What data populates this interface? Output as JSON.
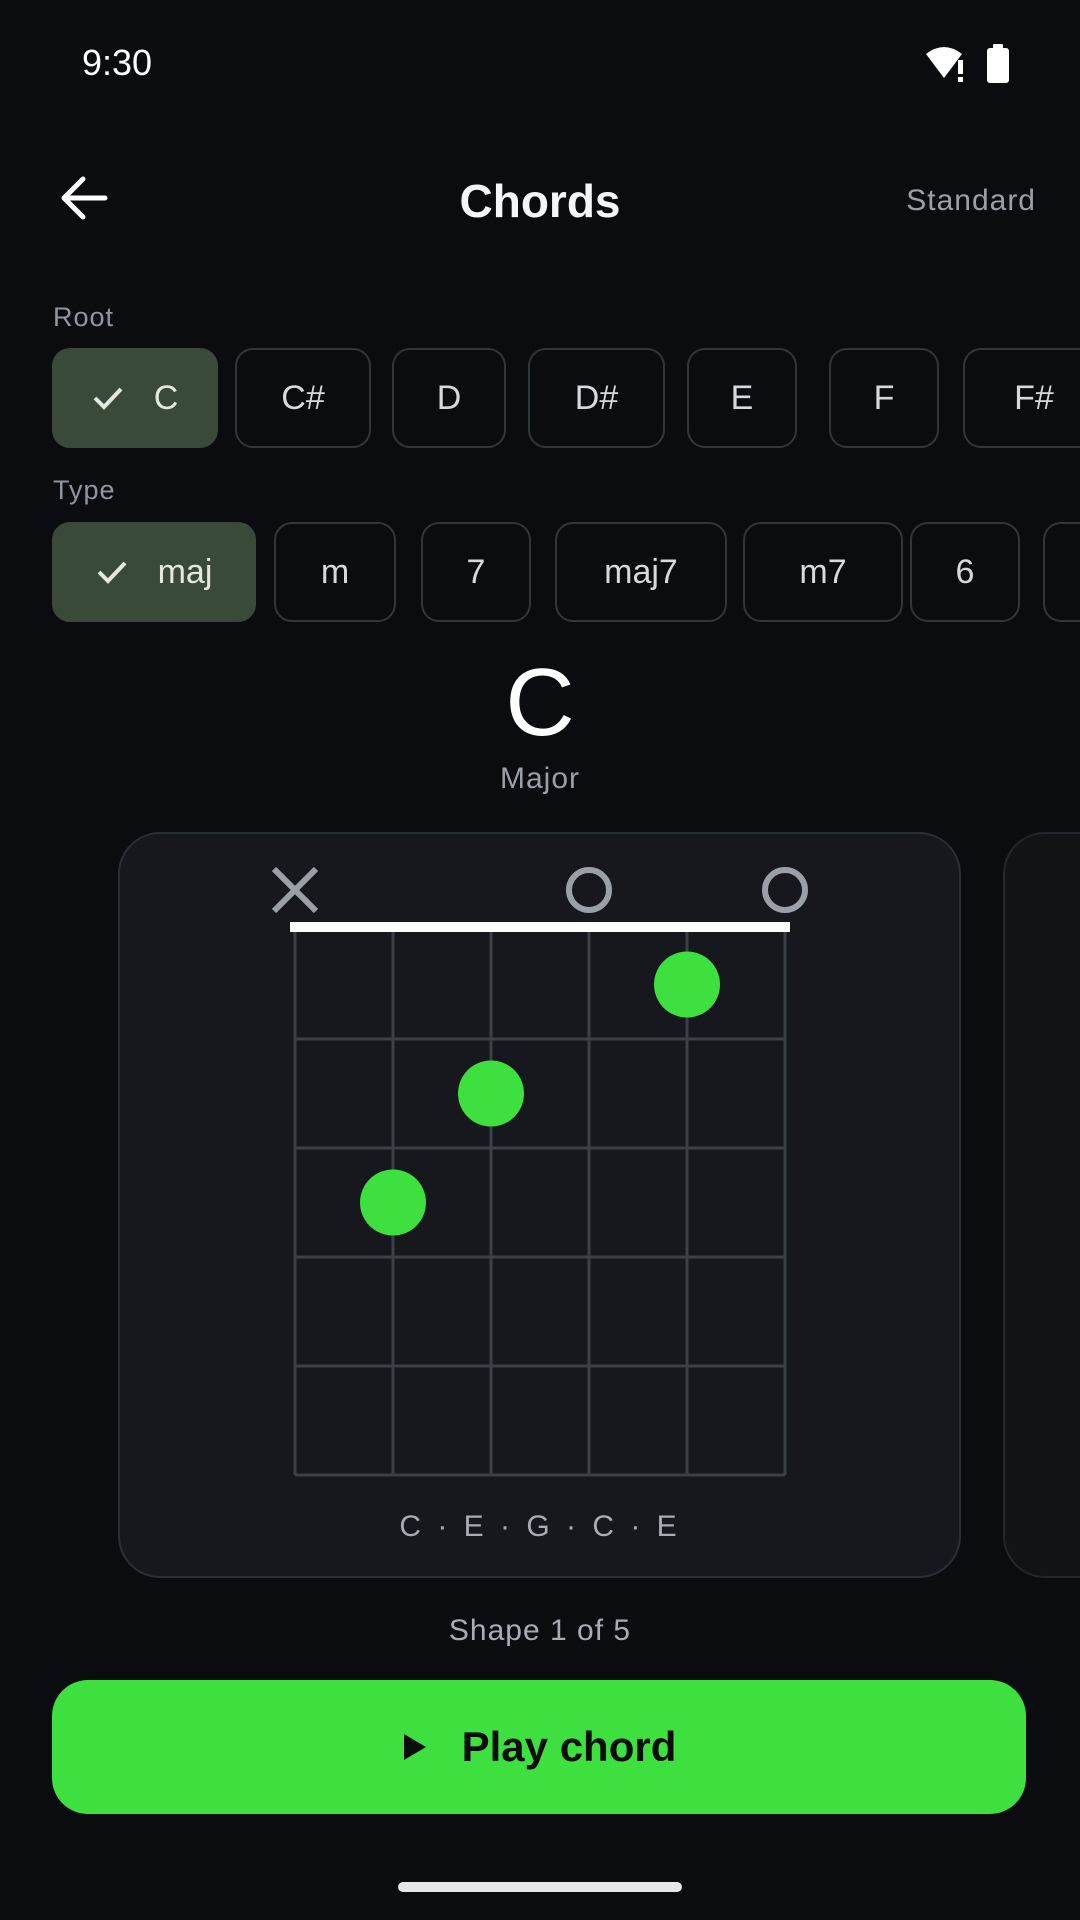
{
  "status": {
    "time": "9:30"
  },
  "app_bar": {
    "title": "Chords",
    "tuning": "Standard"
  },
  "root": {
    "label": "Root",
    "selected": "C",
    "chips": [
      "C",
      "C#",
      "D",
      "D#",
      "E",
      "F",
      "F#"
    ]
  },
  "type": {
    "label": "Type",
    "selected": "maj",
    "chips": [
      "maj",
      "m",
      "7",
      "maj7",
      "m7",
      "6"
    ]
  },
  "chord": {
    "name": "C",
    "quality": "Major",
    "notes": "C · E · G · C · E",
    "strings": [
      "x",
      3,
      2,
      0,
      1,
      0
    ],
    "frets_shown": 5
  },
  "shape": {
    "counter": "Shape 1 of 5"
  },
  "actions": {
    "play_label": "Play chord"
  },
  "colors": {
    "accent": "#3ee03f",
    "selected_chip": "#3a4a38",
    "background": "#0a0c10"
  },
  "icons": {
    "back": "arrow-left-icon",
    "check": "check-icon",
    "play": "play-icon",
    "wifi": "wifi-alert-icon",
    "battery": "battery-icon"
  }
}
